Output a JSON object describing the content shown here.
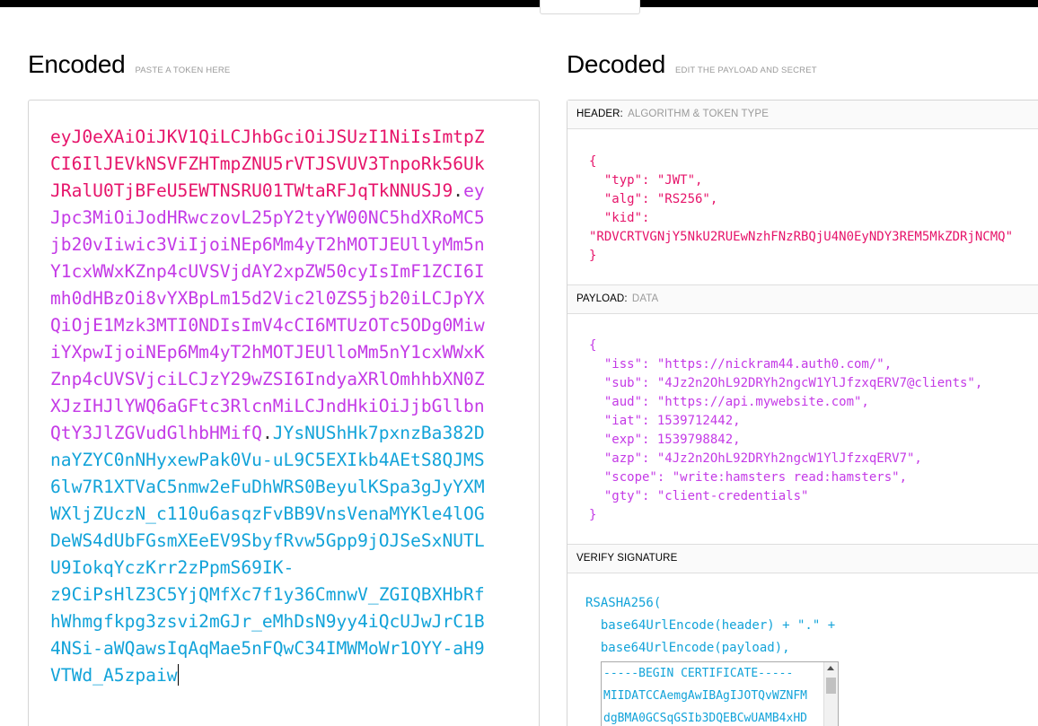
{
  "encoded": {
    "title": "Encoded",
    "hint": "PASTE A TOKEN HERE",
    "token_header": "eyJ0eXAiOiJKV1QiLCJhbGciOiJSUzI1NiIsImtpZCI6IlJEVkNSVFZHTmpZNU5rVTJSVUV3TnpoRk56UkJRalU0TjBFeU5EWTNSRU01TWtaRFJqTkNNUSJ9",
    "token_payload": "eyJpc3MiOiJodHRwczovL25pY2tyYW00NC5hdXRoMC5jb20vIiwic3ViIjoiNEp6Mm4yT2hMOTJEUllyMm5nY1cxWWxKZnp4cUVSVjdAY2xpZW50cyIsImF1ZCI6Imh0dHBzOi8vYXBpLm15d2Vic2l0ZS5jb20iLCJpYXQiOjE1Mzk3MTI0NDIsImV4cCI6MTUzOTc5ODg0MiwiYXpwIjoiNEp6Mm4yT2hMOTJEUlloMm5nY1cxWWxKZnp4cUVSVjciLCJzY29wZSI6IndyaXRlOmhhbXN0ZXJzIHJlYWQ6aGFtc3RlcnMiLCJndHkiOiJjbGllbnQtY3JlZGVudGlhbHMifQ",
    "token_signature": "JYsNUShHk7pxnzBa382DnaYZYC0nNHyxewPak0Vu-uL9C5EXIkb4AEtS8QJMS6lw7R1XTVaC5nmw2eFuDhWRS0BeyulKSpa3gJyYXMWXljZUczN_c110u6asqzFvBB9VnsVenaMYKle4lOGDeWS4dUbFGsmXEeEV9SbyfRvw5Gpp9jOJSeSxNUTLU9IokqYczKrr2zPpmS69IK-",
    "token_signature_2": "z9CiPsHlZ3C5YjQMfXc7f1y36CmnwV_ZGIQBXHbRfhWhmgfkpg3zsvi2mGJr_eMhDsN9yy4iQcUJwJrC1B4NSi-aWQawsIqAqMae5nFQwC34IMWMoWr1OYY-aH9VTWd_A5zpaiw",
    "dot": "."
  },
  "decoded": {
    "title": "Decoded",
    "hint": "EDIT THE PAYLOAD AND SECRET",
    "header_label": "HEADER:",
    "header_sub": "ALGORITHM & TOKEN TYPE",
    "header_json": "{\n  \"typ\": \"JWT\",\n  \"alg\": \"RS256\",\n  \"kid\":\n\"RDVCRTVGNjY5NkU2RUEwNzhFNzRBQjU4N0EyNDY3REM5MkZDRjNCMQ\"\n}",
    "payload_label": "PAYLOAD:",
    "payload_sub": "DATA",
    "payload_json": "{\n  \"iss\": \"https://nickram44.auth0.com/\",\n  \"sub\": \"4Jz2n2OhL92DRYh2ngcW1YlJfzxqERV7@clients\",\n  \"aud\": \"https://api.mywebsite.com\",\n  \"iat\": 1539712442,\n  \"exp\": 1539798842,\n  \"azp\": \"4Jz2n2OhL92DRYh2ngcW1YlJfzxqERV7\",\n  \"scope\": \"write:hamsters read:hamsters\",\n  \"gty\": \"client-credentials\"\n}",
    "verify_label": "VERIFY SIGNATURE",
    "verify_code": "RSASHA256(\n  base64UrlEncode(header) + \".\" +\n  base64UrlEncode(payload),",
    "cert_text": "-----BEGIN CERTIFICATE-----\nMIIDATCCAemgAwIBAgIJOTQvWZNFM\ndgBMA0GCSqGSIb3DQEBCwUAMB4xHD"
  }
}
